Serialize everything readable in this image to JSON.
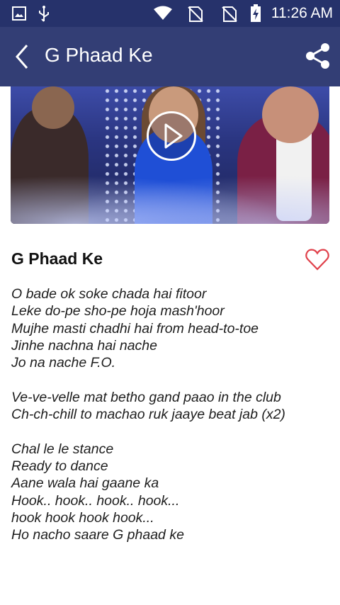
{
  "status_bar": {
    "time": "11:26 AM",
    "icons": [
      "image-icon",
      "usb-icon",
      "wifi-icon",
      "no-sim-icon",
      "no-sim-icon",
      "battery-charging-icon"
    ]
  },
  "app_bar": {
    "title": "G Phaad Ke",
    "back_icon": "chevron-left-icon",
    "share_icon": "share-icon"
  },
  "video": {
    "play_icon": "play-icon"
  },
  "song": {
    "title": "G Phaad Ke",
    "favorite_icon": "heart-outline-icon",
    "accent_color": "#e0404a"
  },
  "lyrics": {
    "stanza1": [
      "O bade ok soke chada hai fitoor",
      "Leke do-pe sho-pe hoja mash'hoor",
      "Mujhe masti chadhi hai from head-to-toe",
      "Jinhe nachna hai nache",
      "Jo na nache F.O."
    ],
    "stanza2": [
      "Ve-ve-velle mat betho gand paao in the club",
      "Ch-ch-chill to machao ruk jaaye beat jab (x2)"
    ],
    "stanza3": [
      "Chal le le stance",
      "Ready to dance",
      "Aane wala hai gaane ka",
      "Hook.. hook.. hook.. hook...",
      "hook hook hook hook...",
      "Ho nacho saare G phaad ke"
    ]
  },
  "colors": {
    "status_bar": "#26326b",
    "app_bar": "#333e75"
  }
}
